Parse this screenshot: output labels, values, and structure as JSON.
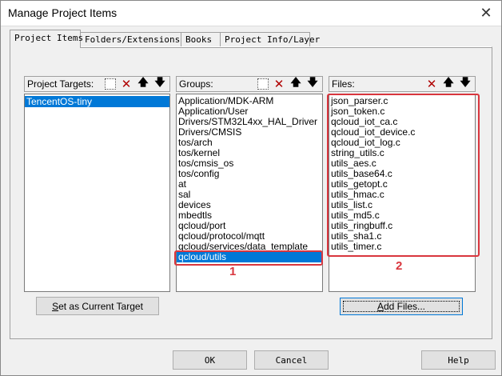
{
  "window": {
    "title": "Manage Project Items",
    "close_glyph": "✕"
  },
  "tabs": [
    {
      "label": "Project Items",
      "active": true
    },
    {
      "label": "Folders/Extensions",
      "active": false
    },
    {
      "label": "Books",
      "active": false
    },
    {
      "label": "Project Info/Layer",
      "active": false
    }
  ],
  "targets": {
    "label": "Project Targets:",
    "items": [
      "TencentOS-tiny"
    ],
    "selected_index": 0,
    "set_current_button": "Set as Current Target"
  },
  "groups": {
    "label": "Groups:",
    "items": [
      "Application/MDK-ARM",
      "Application/User",
      "Drivers/STM32L4xx_HAL_Driver",
      "Drivers/CMSIS",
      "tos/arch",
      "tos/kernel",
      "tos/cmsis_os",
      "tos/config",
      "at",
      "sal",
      "devices",
      "mbedtls",
      "qcloud/port",
      "qcloud/protocol/mqtt",
      "qcloud/services/data_template",
      "qcloud/utils"
    ],
    "selected_index": 15
  },
  "files": {
    "label": "Files:",
    "items": [
      "json_parser.c",
      "json_token.c",
      "qcloud_iot_ca.c",
      "qcloud_iot_device.c",
      "qcloud_iot_log.c",
      "string_utils.c",
      "utils_aes.c",
      "utils_base64.c",
      "utils_getopt.c",
      "utils_hmac.c",
      "utils_list.c",
      "utils_md5.c",
      "utils_ringbuff.c",
      "utils_sha1.c",
      "utils_timer.c"
    ],
    "add_files_button": "Add Files..."
  },
  "annotations": {
    "groups_marker": "1",
    "files_marker": "2",
    "color": "#d9363e"
  },
  "footer": {
    "ok": "OK",
    "cancel": "Cancel",
    "help": "Help"
  },
  "toolbar_glyphs": {
    "new": "",
    "delete": "✕",
    "up": "🡅",
    "down": "🡇"
  },
  "colors": {
    "selection": "#0078d7",
    "dialog_bg": "#f0f0f0"
  }
}
